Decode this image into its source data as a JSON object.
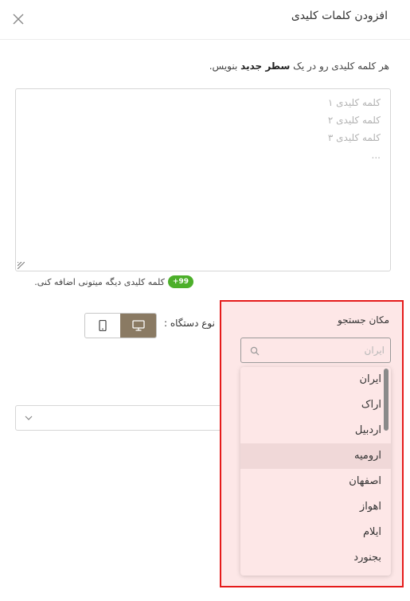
{
  "header": {
    "title": "افزودن کلمات کلیدی"
  },
  "instruction": {
    "before": "هر کلمه کلیدی رو در یک ",
    "bold": "سطر جدید",
    "after": " بنویس."
  },
  "keywords": {
    "value": "",
    "placeholder_lines": [
      "کلمه کلیدی ۱",
      "کلمه کلیدی ۲",
      "کلمه کلیدی ۳",
      "..."
    ]
  },
  "counter": {
    "badge": "+99",
    "text": "کلمه کلیدی دیگه میتونی اضافه کنی."
  },
  "device": {
    "label": "نوع دستگاه :",
    "selected": "desktop",
    "accent": "#8a7a63"
  },
  "location": {
    "label": "مکان جستجو",
    "search_placeholder": "ایران",
    "options": [
      "ایران",
      "اراک",
      "اردبیل",
      "ارومیه",
      "اصفهان",
      "اهواز",
      "ایلام",
      "بجنورد"
    ],
    "hovered": "ارومیه"
  },
  "colors": {
    "highlight_border": "#e51b1b",
    "panel_bg": "#fde7e7",
    "badge_bg": "#4caf2a"
  }
}
